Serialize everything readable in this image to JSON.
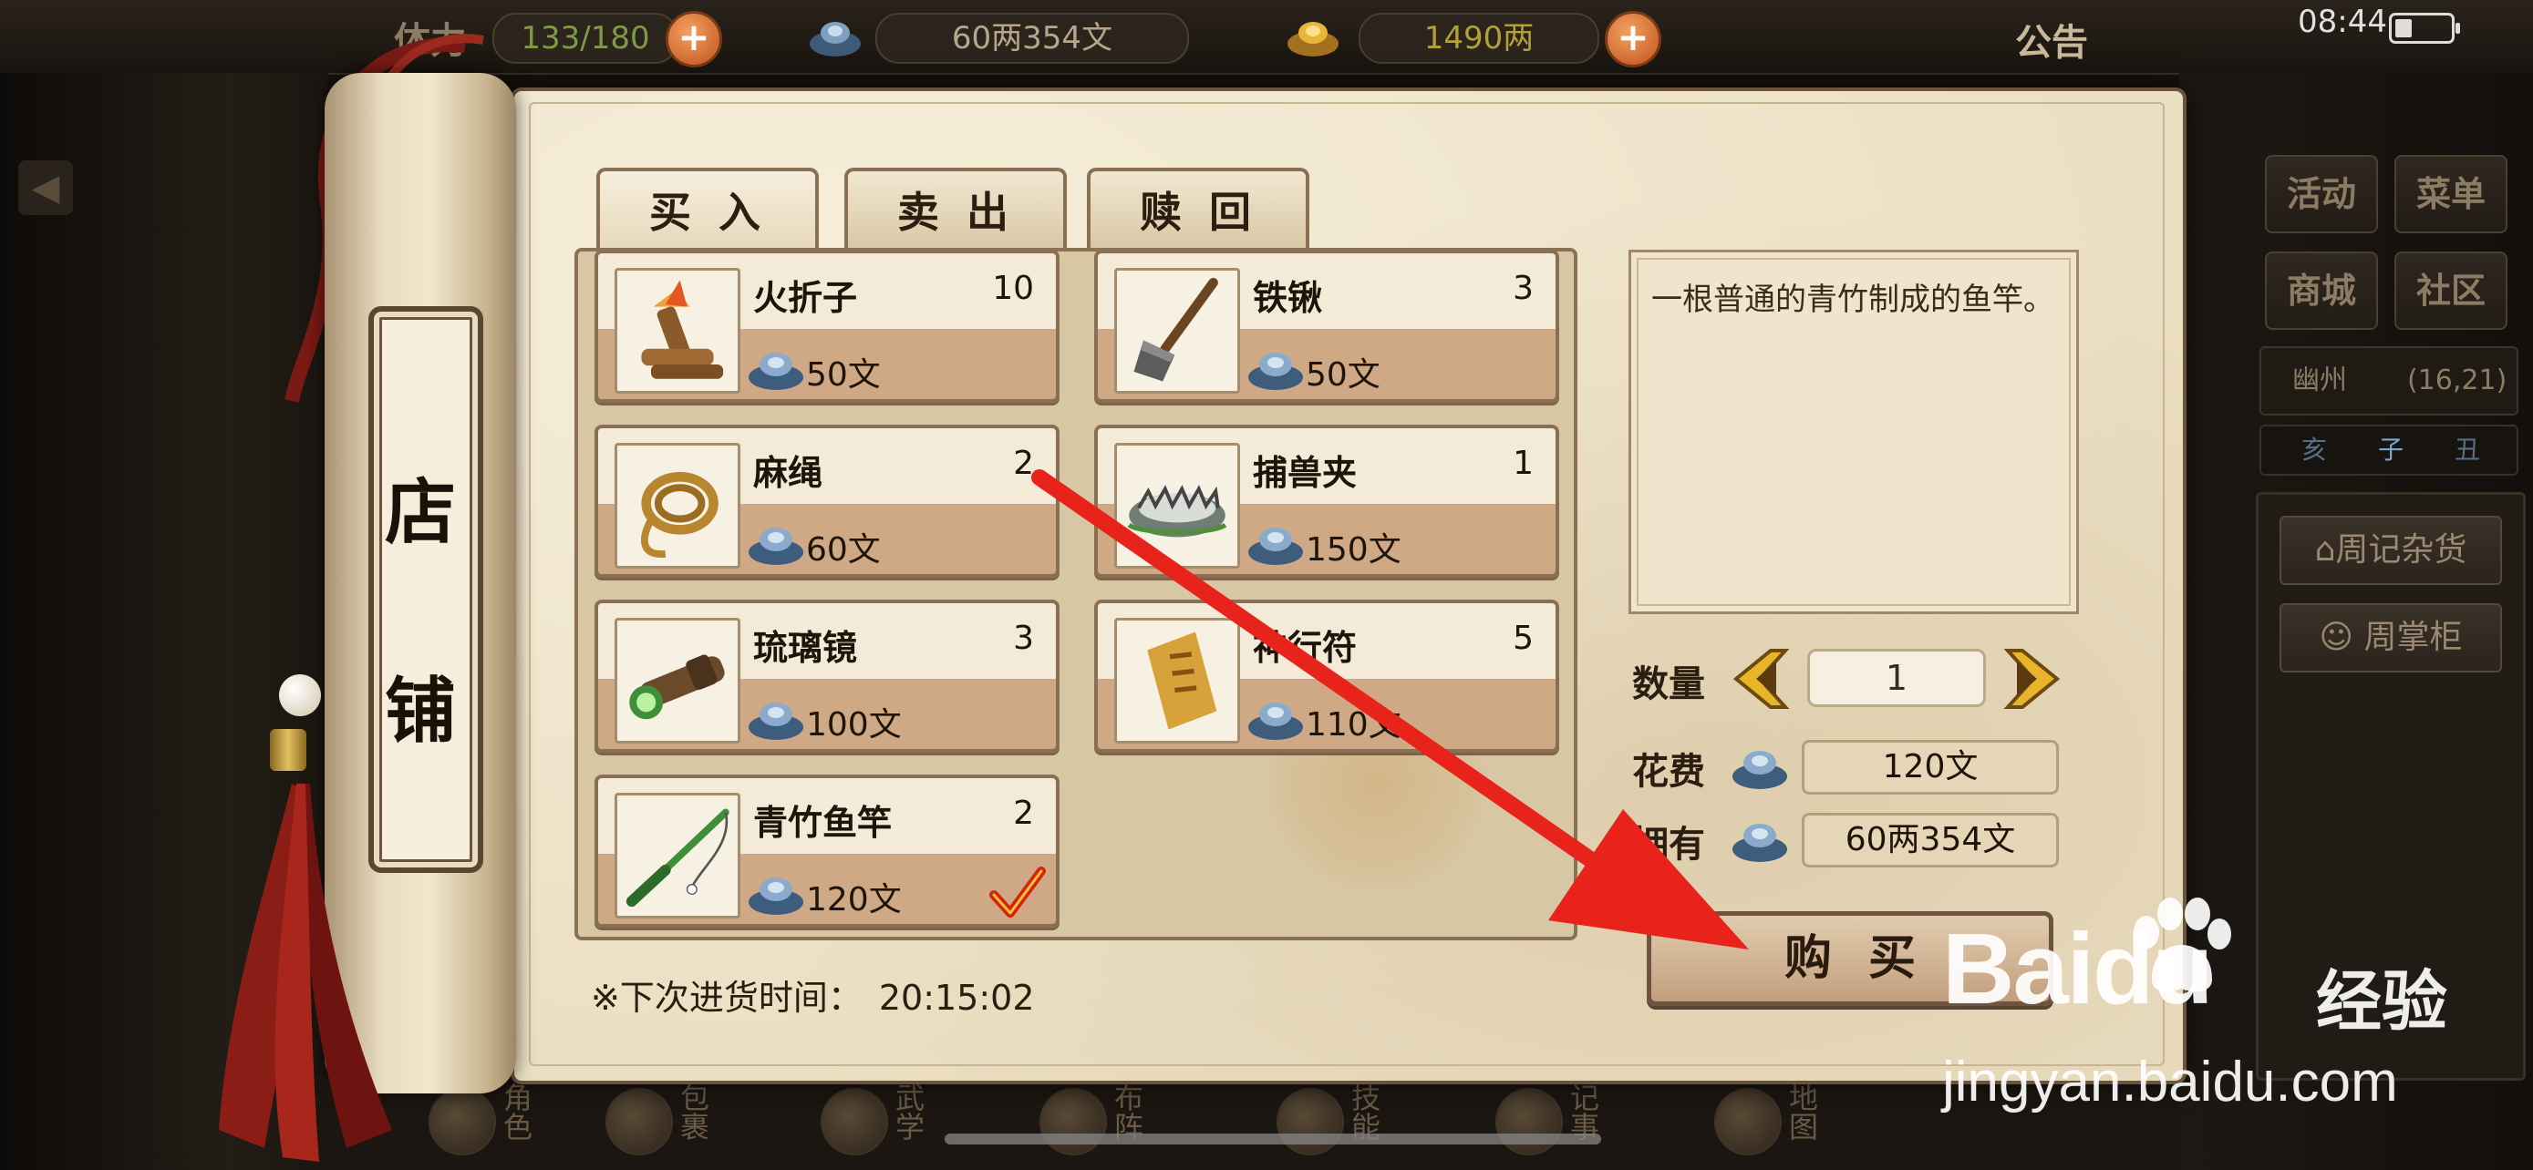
{
  "status_bar": {
    "stamina_label": "体力",
    "stamina": "133/180",
    "silver": "60两354文",
    "gold": "1490两",
    "notice": "公告",
    "time": "08:44"
  },
  "shop": {
    "title_chars": [
      "店",
      "铺"
    ],
    "tabs": [
      {
        "label": "买入",
        "active": true
      },
      {
        "label": "卖出",
        "active": false
      },
      {
        "label": "赎回",
        "active": false
      }
    ],
    "items": [
      {
        "name": "火折子",
        "count": "10",
        "price": "50文",
        "icon": "torch-icon"
      },
      {
        "name": "铁锹",
        "count": "3",
        "price": "50文",
        "icon": "shovel-icon"
      },
      {
        "name": "麻绳",
        "count": "2",
        "price": "60文",
        "icon": "rope-icon"
      },
      {
        "name": "捕兽夹",
        "count": "1",
        "price": "150文",
        "icon": "trap-icon"
      },
      {
        "name": "琉璃镜",
        "count": "3",
        "price": "100文",
        "icon": "telescope-icon"
      },
      {
        "name": "神行符",
        "count": "5",
        "price": "110文",
        "icon": "talisman-icon"
      },
      {
        "name": "青竹鱼竿",
        "count": "2",
        "price": "120文",
        "icon": "fishing-rod-icon",
        "selected": true
      }
    ],
    "restock_label": "※下次进货时间：",
    "restock_time": "20:15:02",
    "description": "一根普通的青竹制成的鱼竿。",
    "quantity_label": "数量",
    "quantity": "1",
    "cost_label": "花费",
    "cost": "120文",
    "owned_label": "拥有",
    "owned": "60两354文",
    "buy_label": "购买"
  },
  "side_menu": {
    "buttons": [
      "活动",
      "菜单",
      "商城",
      "社区"
    ],
    "location": "幽州",
    "coords": "(16,21)",
    "time_marks": [
      "亥",
      "子",
      "丑"
    ],
    "npcs": [
      "周记杂货",
      "周掌柜"
    ]
  },
  "bottom_nav": [
    "角色",
    "包裹",
    "武学",
    "布阵",
    "技能",
    "记事",
    "地图"
  ],
  "watermark": {
    "brand": "Baidu",
    "suffix": "经验",
    "url": "jingyan.baidu.com"
  },
  "colors": {
    "accent_red": "#e8231c",
    "parchment": "#ebdfc3",
    "frame_brown": "#6b543c"
  }
}
